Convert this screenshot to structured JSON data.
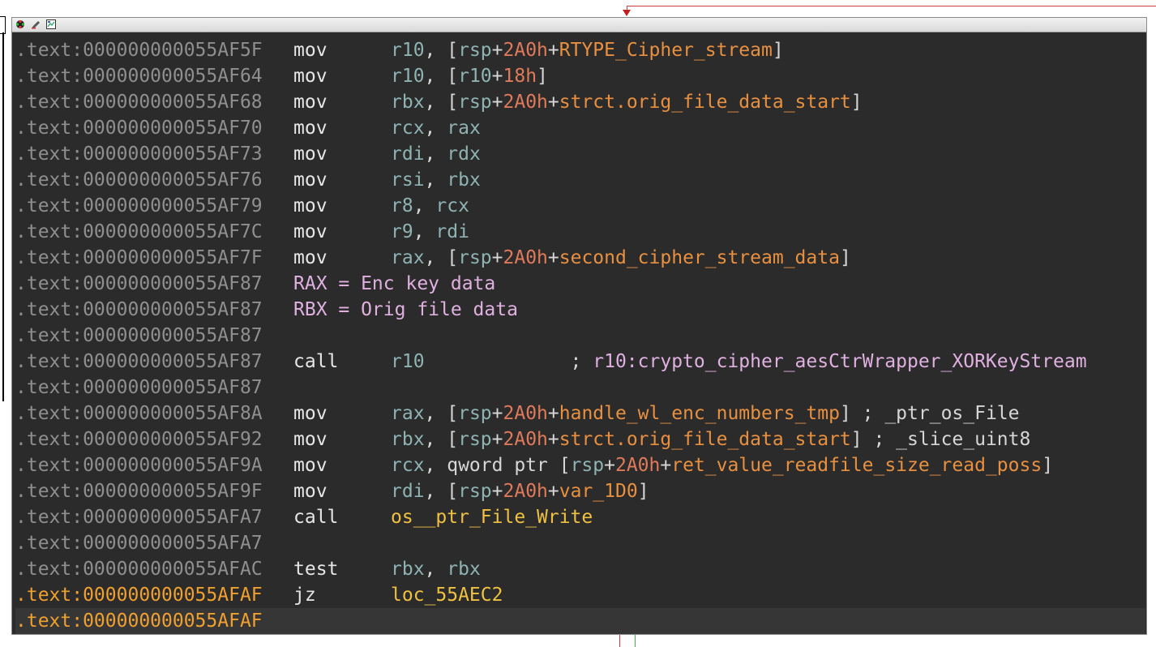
{
  "window": {
    "title_icons": [
      "graph-overview-icon",
      "edit-color-icon",
      "zoom-view-icon"
    ]
  },
  "lines": [
    {
      "addr": ".text:000000000055AF5F",
      "mnem": "mov",
      "ops": [
        [
          "reg",
          "r10"
        ],
        [
          "pun",
          ", ["
        ],
        [
          "reg",
          "rsp"
        ],
        [
          "pun",
          "+"
        ],
        [
          "num",
          "2A0h"
        ],
        [
          "pun",
          "+"
        ],
        [
          "sym",
          "RTYPE_Cipher_stream"
        ],
        [
          "pun",
          "]"
        ]
      ]
    },
    {
      "addr": ".text:000000000055AF64",
      "mnem": "mov",
      "ops": [
        [
          "reg",
          "r10"
        ],
        [
          "pun",
          ", ["
        ],
        [
          "reg",
          "r10"
        ],
        [
          "pun",
          "+"
        ],
        [
          "num",
          "18h"
        ],
        [
          "pun",
          "]"
        ]
      ]
    },
    {
      "addr": ".text:000000000055AF68",
      "mnem": "mov",
      "ops": [
        [
          "reg",
          "rbx"
        ],
        [
          "pun",
          ", ["
        ],
        [
          "reg",
          "rsp"
        ],
        [
          "pun",
          "+"
        ],
        [
          "num",
          "2A0h"
        ],
        [
          "pun",
          "+"
        ],
        [
          "sym",
          "strct.orig_file_data_start"
        ],
        [
          "pun",
          "]"
        ]
      ]
    },
    {
      "addr": ".text:000000000055AF70",
      "mnem": "mov",
      "ops": [
        [
          "reg",
          "rcx"
        ],
        [
          "pun",
          ", "
        ],
        [
          "reg",
          "rax"
        ]
      ]
    },
    {
      "addr": ".text:000000000055AF73",
      "mnem": "mov",
      "ops": [
        [
          "reg",
          "rdi"
        ],
        [
          "pun",
          ", "
        ],
        [
          "reg",
          "rdx"
        ]
      ]
    },
    {
      "addr": ".text:000000000055AF76",
      "mnem": "mov",
      "ops": [
        [
          "reg",
          "rsi"
        ],
        [
          "pun",
          ", "
        ],
        [
          "reg",
          "rbx"
        ]
      ]
    },
    {
      "addr": ".text:000000000055AF79",
      "mnem": "mov",
      "ops": [
        [
          "reg",
          "r8"
        ],
        [
          "pun",
          ", "
        ],
        [
          "reg",
          "rcx"
        ]
      ]
    },
    {
      "addr": ".text:000000000055AF7C",
      "mnem": "mov",
      "ops": [
        [
          "reg",
          "r9"
        ],
        [
          "pun",
          ", "
        ],
        [
          "reg",
          "rdi"
        ]
      ]
    },
    {
      "addr": ".text:000000000055AF7F",
      "mnem": "mov",
      "ops": [
        [
          "reg",
          "rax"
        ],
        [
          "pun",
          ", ["
        ],
        [
          "reg",
          "rsp"
        ],
        [
          "pun",
          "+"
        ],
        [
          "num",
          "2A0h"
        ],
        [
          "pun",
          "+"
        ],
        [
          "sym",
          "second_cipher_stream_data"
        ],
        [
          "pun",
          "]"
        ]
      ]
    },
    {
      "addr": ".text:000000000055AF87",
      "comment": "RAX = Enc key data"
    },
    {
      "addr": ".text:000000000055AF87",
      "comment": "RBX = Orig file data"
    },
    {
      "addr": ".text:000000000055AF87"
    },
    {
      "addr": ".text:000000000055AF87",
      "mnem": "call",
      "ops": [
        [
          "reg",
          "r10"
        ],
        [
          "rc",
          "             ; "
        ],
        [
          "rcx",
          "r10:crypto_cipher_aesCtrWrapper_XORKeyStream"
        ]
      ]
    },
    {
      "addr": ".text:000000000055AF87"
    },
    {
      "addr": ".text:000000000055AF8A",
      "mnem": "mov",
      "ops": [
        [
          "reg",
          "rax"
        ],
        [
          "pun",
          ", ["
        ],
        [
          "reg",
          "rsp"
        ],
        [
          "pun",
          "+"
        ],
        [
          "num",
          "2A0h"
        ],
        [
          "pun",
          "+"
        ],
        [
          "sym",
          "handle_wl_enc_numbers_tmp"
        ],
        [
          "pun",
          "] "
        ],
        [
          "rc",
          "; _ptr_os_File"
        ]
      ]
    },
    {
      "addr": ".text:000000000055AF92",
      "mnem": "mov",
      "ops": [
        [
          "reg",
          "rbx"
        ],
        [
          "pun",
          ", ["
        ],
        [
          "reg",
          "rsp"
        ],
        [
          "pun",
          "+"
        ],
        [
          "num",
          "2A0h"
        ],
        [
          "pun",
          "+"
        ],
        [
          "sym",
          "strct.orig_file_data_start"
        ],
        [
          "pun",
          "] "
        ],
        [
          "rc",
          "; _slice_uint8"
        ]
      ]
    },
    {
      "addr": ".text:000000000055AF9A",
      "mnem": "mov",
      "ops": [
        [
          "reg",
          "rcx"
        ],
        [
          "pun",
          ", qword ptr ["
        ],
        [
          "reg",
          "rsp"
        ],
        [
          "pun",
          "+"
        ],
        [
          "num",
          "2A0h"
        ],
        [
          "pun",
          "+"
        ],
        [
          "sym",
          "ret_value_readfile_size_read_poss"
        ],
        [
          "pun",
          "]"
        ]
      ]
    },
    {
      "addr": ".text:000000000055AF9F",
      "mnem": "mov",
      "ops": [
        [
          "reg",
          "rdi"
        ],
        [
          "pun",
          ", ["
        ],
        [
          "reg",
          "rsp"
        ],
        [
          "pun",
          "+"
        ],
        [
          "num",
          "2A0h"
        ],
        [
          "pun",
          "+"
        ],
        [
          "sym",
          "var_1D0"
        ],
        [
          "pun",
          "]"
        ]
      ]
    },
    {
      "addr": ".text:000000000055AFA7",
      "mnem": "call",
      "ops": [
        [
          "fn",
          "os__ptr_File_Write"
        ]
      ]
    },
    {
      "addr": ".text:000000000055AFA7"
    },
    {
      "addr": ".text:000000000055AFAC",
      "mnem": "test",
      "ops": [
        [
          "reg",
          "rbx"
        ],
        [
          "pun",
          ", "
        ],
        [
          "reg",
          "rbx"
        ]
      ]
    },
    {
      "addr": ".text:000000000055AFAF",
      "mnem": "jz",
      "highlight": true,
      "ops": [
        [
          "fn",
          "loc_55AEC2"
        ]
      ]
    },
    {
      "addr": ".text:000000000055AFAF",
      "highlight": true,
      "current": true
    }
  ]
}
